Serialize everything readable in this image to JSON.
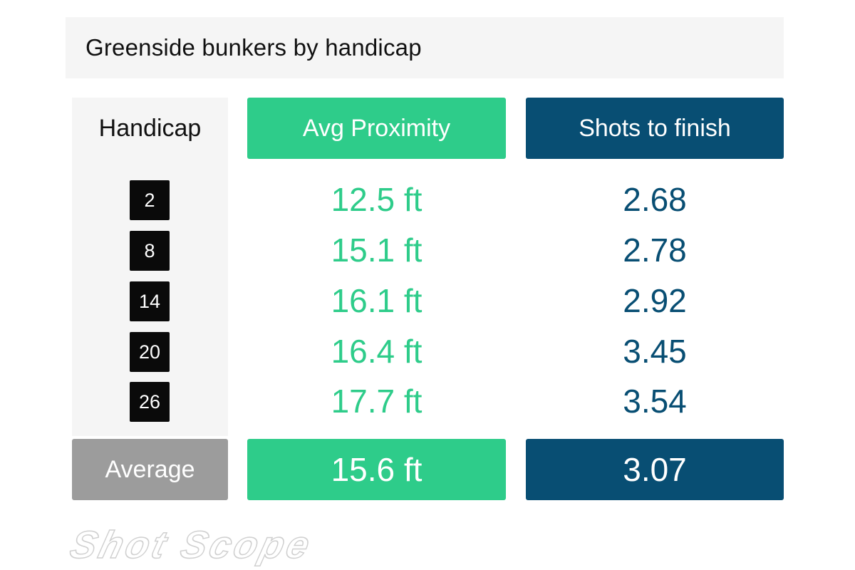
{
  "chart_data": {
    "type": "table",
    "title": "Greenside bunkers by handicap",
    "columns": [
      "Handicap",
      "Avg Proximity",
      "Shots to finish"
    ],
    "rows": [
      {
        "handicap": "2",
        "proximity": "12.5 ft",
        "shots": "2.68"
      },
      {
        "handicap": "8",
        "proximity": "15.1 ft",
        "shots": "2.78"
      },
      {
        "handicap": "14",
        "proximity": "16.1 ft",
        "shots": "2.92"
      },
      {
        "handicap": "20",
        "proximity": "16.4 ft",
        "shots": "3.45"
      },
      {
        "handicap": "26",
        "proximity": "17.7 ft",
        "shots": "3.54"
      }
    ],
    "average": {
      "label": "Average",
      "proximity": "15.6 ft",
      "shots": "3.07"
    }
  },
  "brand": {
    "logo_text": "Shot Scope"
  },
  "colors": {
    "proximity": "#2ecc8a",
    "shots": "#084e73",
    "average_label_bg": "#9c9c9c",
    "badge_bg": "#0a0a0a"
  }
}
